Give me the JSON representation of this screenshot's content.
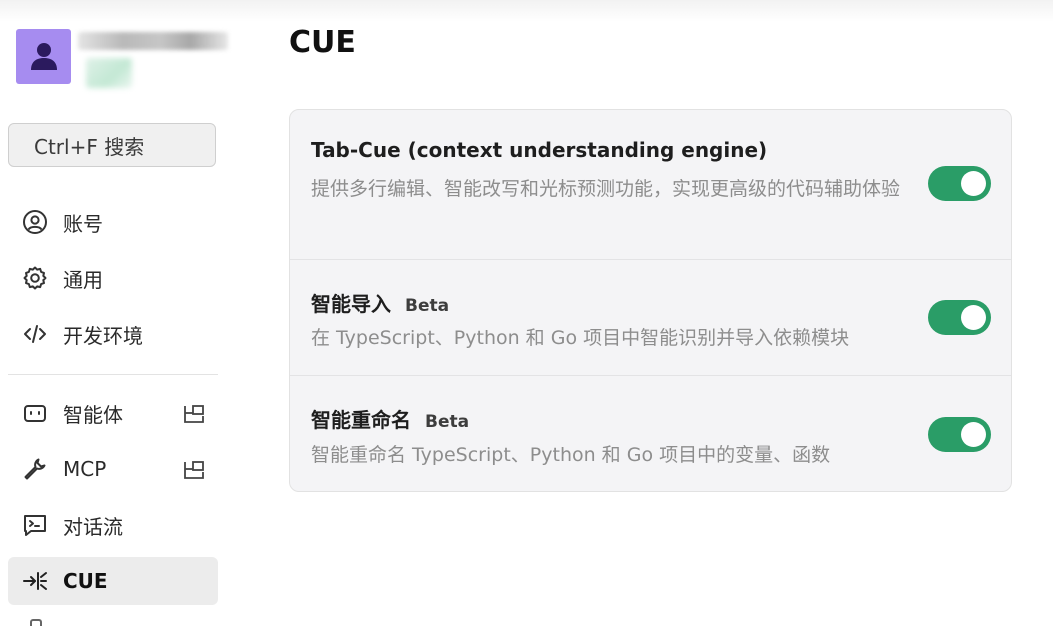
{
  "sidebar": {
    "search_label": "Ctrl+F 搜索",
    "items": [
      {
        "label": "账号",
        "icon": "user-circle-icon"
      },
      {
        "label": "通用",
        "icon": "gear-icon"
      },
      {
        "label": "开发环境",
        "icon": "code-icon"
      },
      {
        "label": "智能体",
        "icon": "bot-icon",
        "external": true
      },
      {
        "label": "MCP",
        "icon": "wrench-icon",
        "external": true
      },
      {
        "label": "对话流",
        "icon": "terminal-chat-icon"
      },
      {
        "label": "CUE",
        "icon": "cue-icon",
        "active": true
      }
    ]
  },
  "main": {
    "title": "CUE",
    "settings": [
      {
        "title": "Tab-Cue (context understanding engine)",
        "badge": "",
        "description": "提供多行编辑、智能改写和光标预测功能，实现更高级的代码辅助体验",
        "enabled": true
      },
      {
        "title": "智能导入",
        "badge": "Beta",
        "description": "在 TypeScript、Python 和 Go 项目中智能识别并导入依赖模块",
        "enabled": true
      },
      {
        "title": "智能重命名",
        "badge": "Beta",
        "description": "智能重命名 TypeScript、Python 和 Go 项目中的变量、函数",
        "enabled": true
      }
    ]
  },
  "colors": {
    "toggle_on": "#2a9d67",
    "avatar_bg": "#a68cf0",
    "active_nav_bg": "#ececec"
  }
}
